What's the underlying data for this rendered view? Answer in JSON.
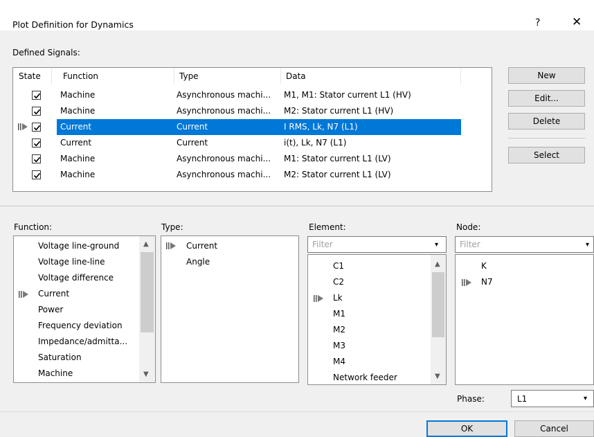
{
  "window": {
    "title": "Plot Definition for Dynamics",
    "help_label": "?",
    "close_label": "✕"
  },
  "defined_signals": {
    "label": "Defined Signals:",
    "columns": [
      "State",
      "Function",
      "Type",
      "Data"
    ],
    "rows": [
      {
        "state": true,
        "function": "Machine",
        "type": "Asynchronous machi...",
        "data": "M1, M1: Stator current L1 (HV)",
        "selected": false
      },
      {
        "state": true,
        "function": "Machine",
        "type": "Asynchronous machi...",
        "data": "M2: Stator current L1 (HV)",
        "selected": false
      },
      {
        "state": true,
        "function": "Current",
        "type": "Current",
        "data": "I RMS, Lk, N7 (L1)",
        "selected": true
      },
      {
        "state": true,
        "function": "Current",
        "type": "Current",
        "data": "i(t), Lk, N7 (L1)",
        "selected": false
      },
      {
        "state": true,
        "function": "Machine",
        "type": "Asynchronous machi...",
        "data": "M1: Stator current L1 (LV)",
        "selected": false
      },
      {
        "state": true,
        "function": "Machine",
        "type": "Asynchronous machi...",
        "data": "M2: Stator current L1 (LV)",
        "selected": false
      }
    ]
  },
  "side_buttons": {
    "new": "New",
    "edit": "Edit...",
    "delete": "Delete",
    "select": "Select"
  },
  "function_list": {
    "label": "Function:",
    "items": [
      "Voltage line-ground",
      "Voltage line-line",
      "Voltage difference",
      "Current",
      "Power",
      "Frequency deviation",
      "Impedance/admitta...",
      "Saturation",
      "Machine"
    ],
    "selected": "Current"
  },
  "type_list": {
    "label": "Type:",
    "items": [
      "Current",
      "Angle"
    ],
    "selected": "Current"
  },
  "element_list": {
    "label": "Element:",
    "filter_placeholder": "Filter",
    "items": [
      "C1",
      "C2",
      "Lk",
      "M1",
      "M2",
      "M3",
      "M4",
      "Network feeder"
    ],
    "selected": "Lk"
  },
  "node_list": {
    "label": "Node:",
    "filter_placeholder": "Filter",
    "items": [
      "K",
      "N7"
    ],
    "selected": "N7"
  },
  "phase": {
    "label": "Phase:",
    "value": "L1"
  },
  "footer": {
    "ok": "OK",
    "cancel": "Cancel"
  },
  "colors": {
    "accent": "#0078d7",
    "window_bg": "#f0f0f0"
  }
}
